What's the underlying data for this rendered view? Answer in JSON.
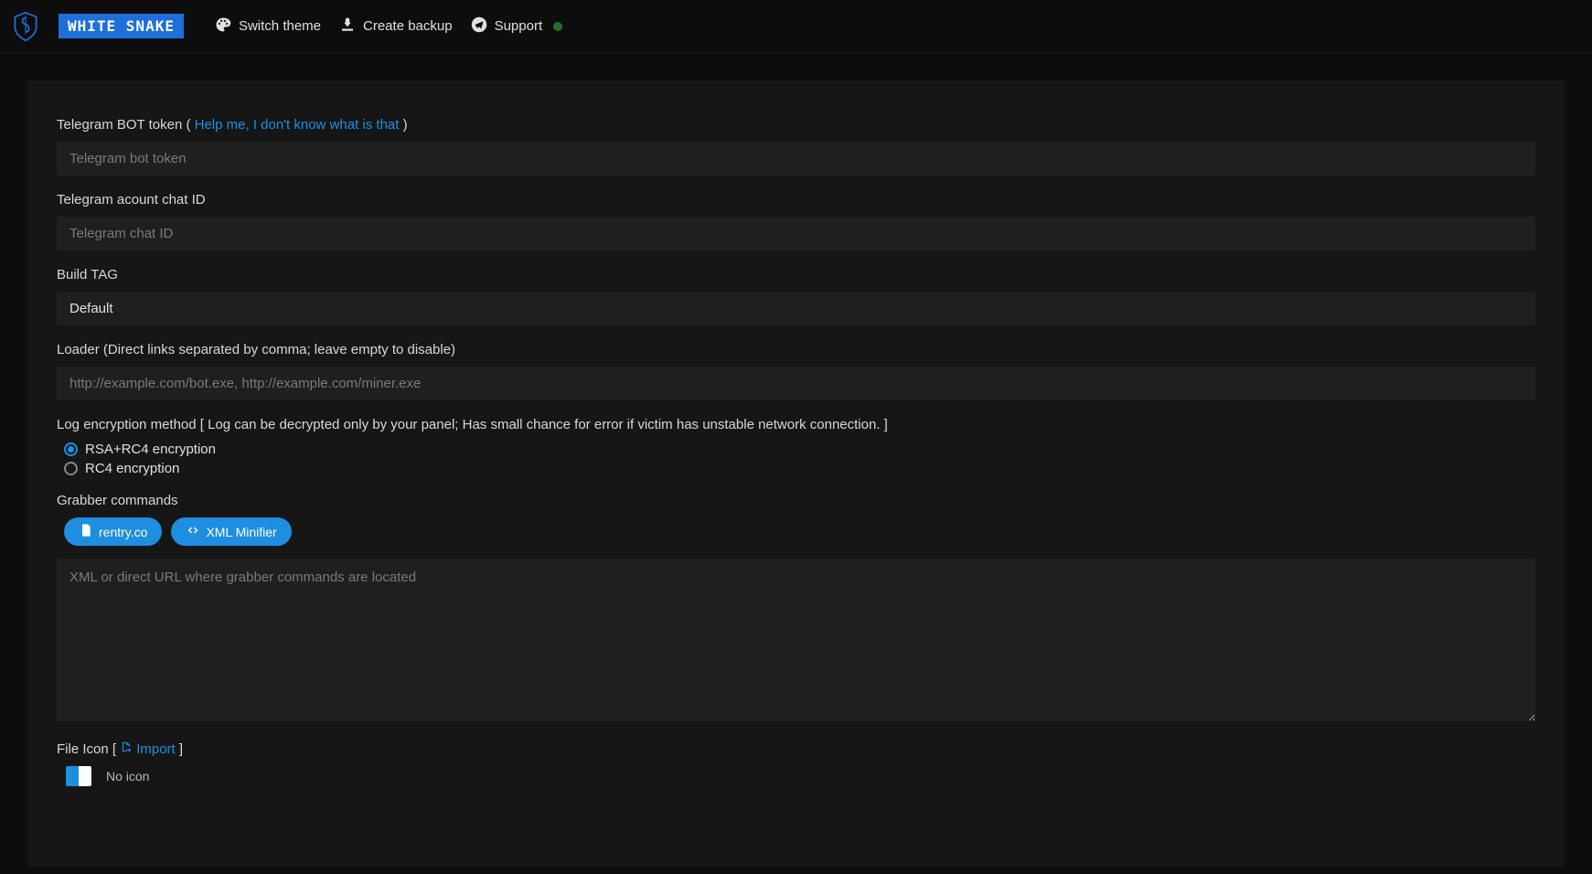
{
  "header": {
    "title": "WHITE SNAKE",
    "nav": {
      "switch_theme": "Switch theme",
      "create_backup": "Create backup",
      "support": "Support"
    }
  },
  "form": {
    "telegram_token": {
      "label_prefix": "Telegram BOT token ( ",
      "help_text": "Help me, I don't know what is that",
      "label_suffix": " )",
      "placeholder": "Telegram bot token",
      "value": ""
    },
    "telegram_chat_id": {
      "label": "Telegram acount chat ID",
      "placeholder": "Telegram chat ID",
      "value": ""
    },
    "build_tag": {
      "label": "Build TAG",
      "value": "Default"
    },
    "loader": {
      "label": "Loader (Direct links separated by comma; leave empty to disable)",
      "placeholder": "http://example.com/bot.exe, http://example.com/miner.exe",
      "value": ""
    },
    "encryption": {
      "label_prefix": "Log encryption method [ ",
      "label_hint": "Log can be decrypted only by your panel; Has small chance for error if victim has unstable network connection.",
      "label_suffix": " ]",
      "option_rsa_rc4": "RSA+RC4 encryption",
      "option_rc4": "RC4 encryption"
    },
    "grabber": {
      "label": "Grabber commands",
      "btn_rentry": "rentry.co",
      "btn_xml": "XML Minifier",
      "placeholder": "XML or direct URL where grabber commands are located",
      "value": ""
    },
    "file_icon": {
      "label_prefix": "File Icon [ ",
      "import_text": "Import",
      "label_suffix": " ]",
      "no_icon": "No icon"
    }
  }
}
